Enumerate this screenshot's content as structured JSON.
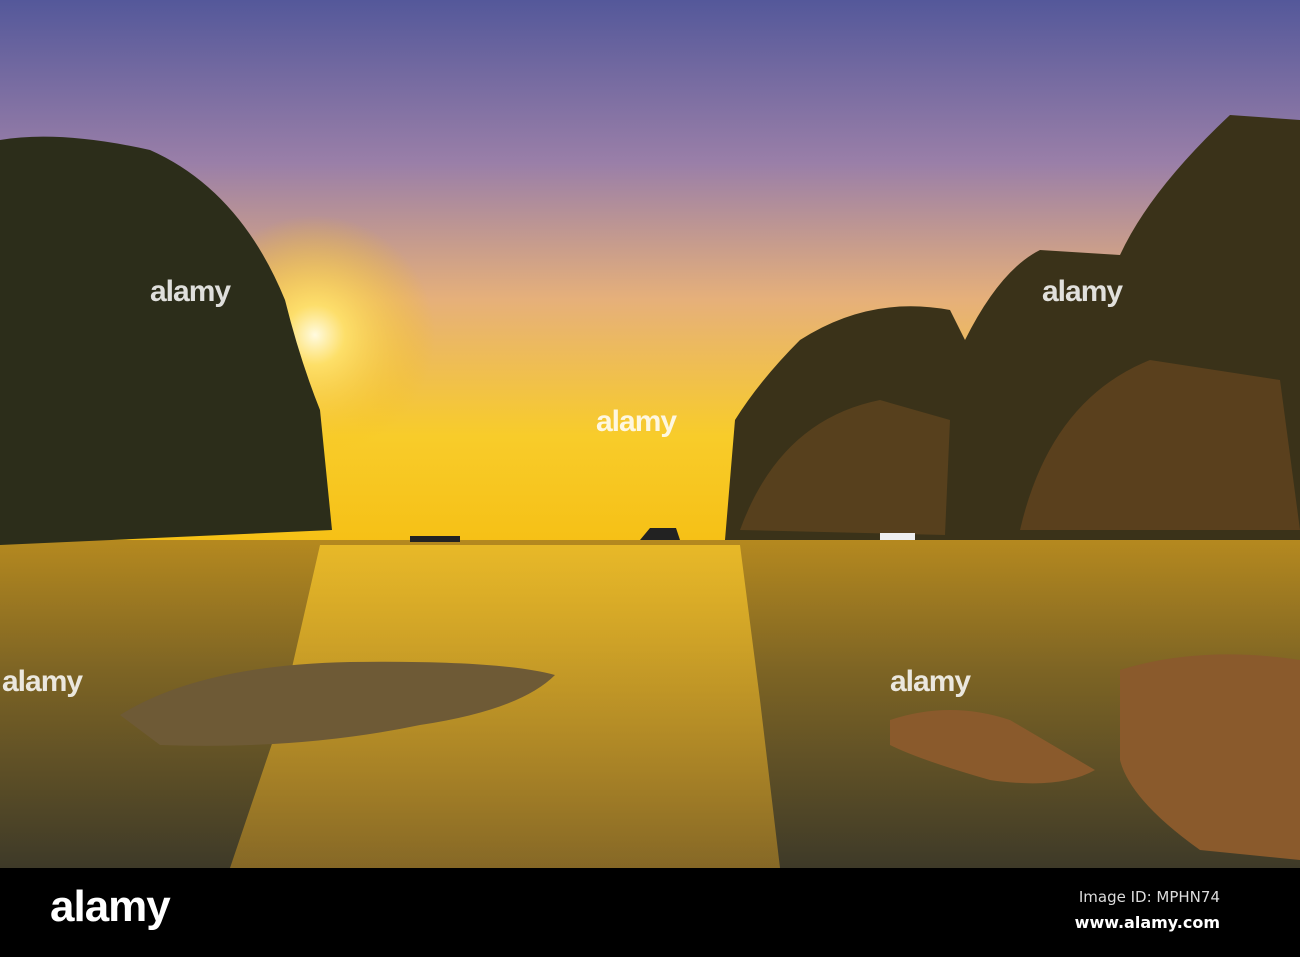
{
  "photo": {
    "subject": "sunset",
    "colors": {
      "sky_top": "#5b5a9a",
      "sky_mid": "#c98c86",
      "horizon": "#f6c21a",
      "water": "#a37a1c",
      "rock": "#2e2e18"
    }
  },
  "watermark": {
    "text": "alamy"
  },
  "footer": {
    "logo": "alamy",
    "image_id": "Image ID: MPHN74",
    "website": "www.alamy.com"
  }
}
